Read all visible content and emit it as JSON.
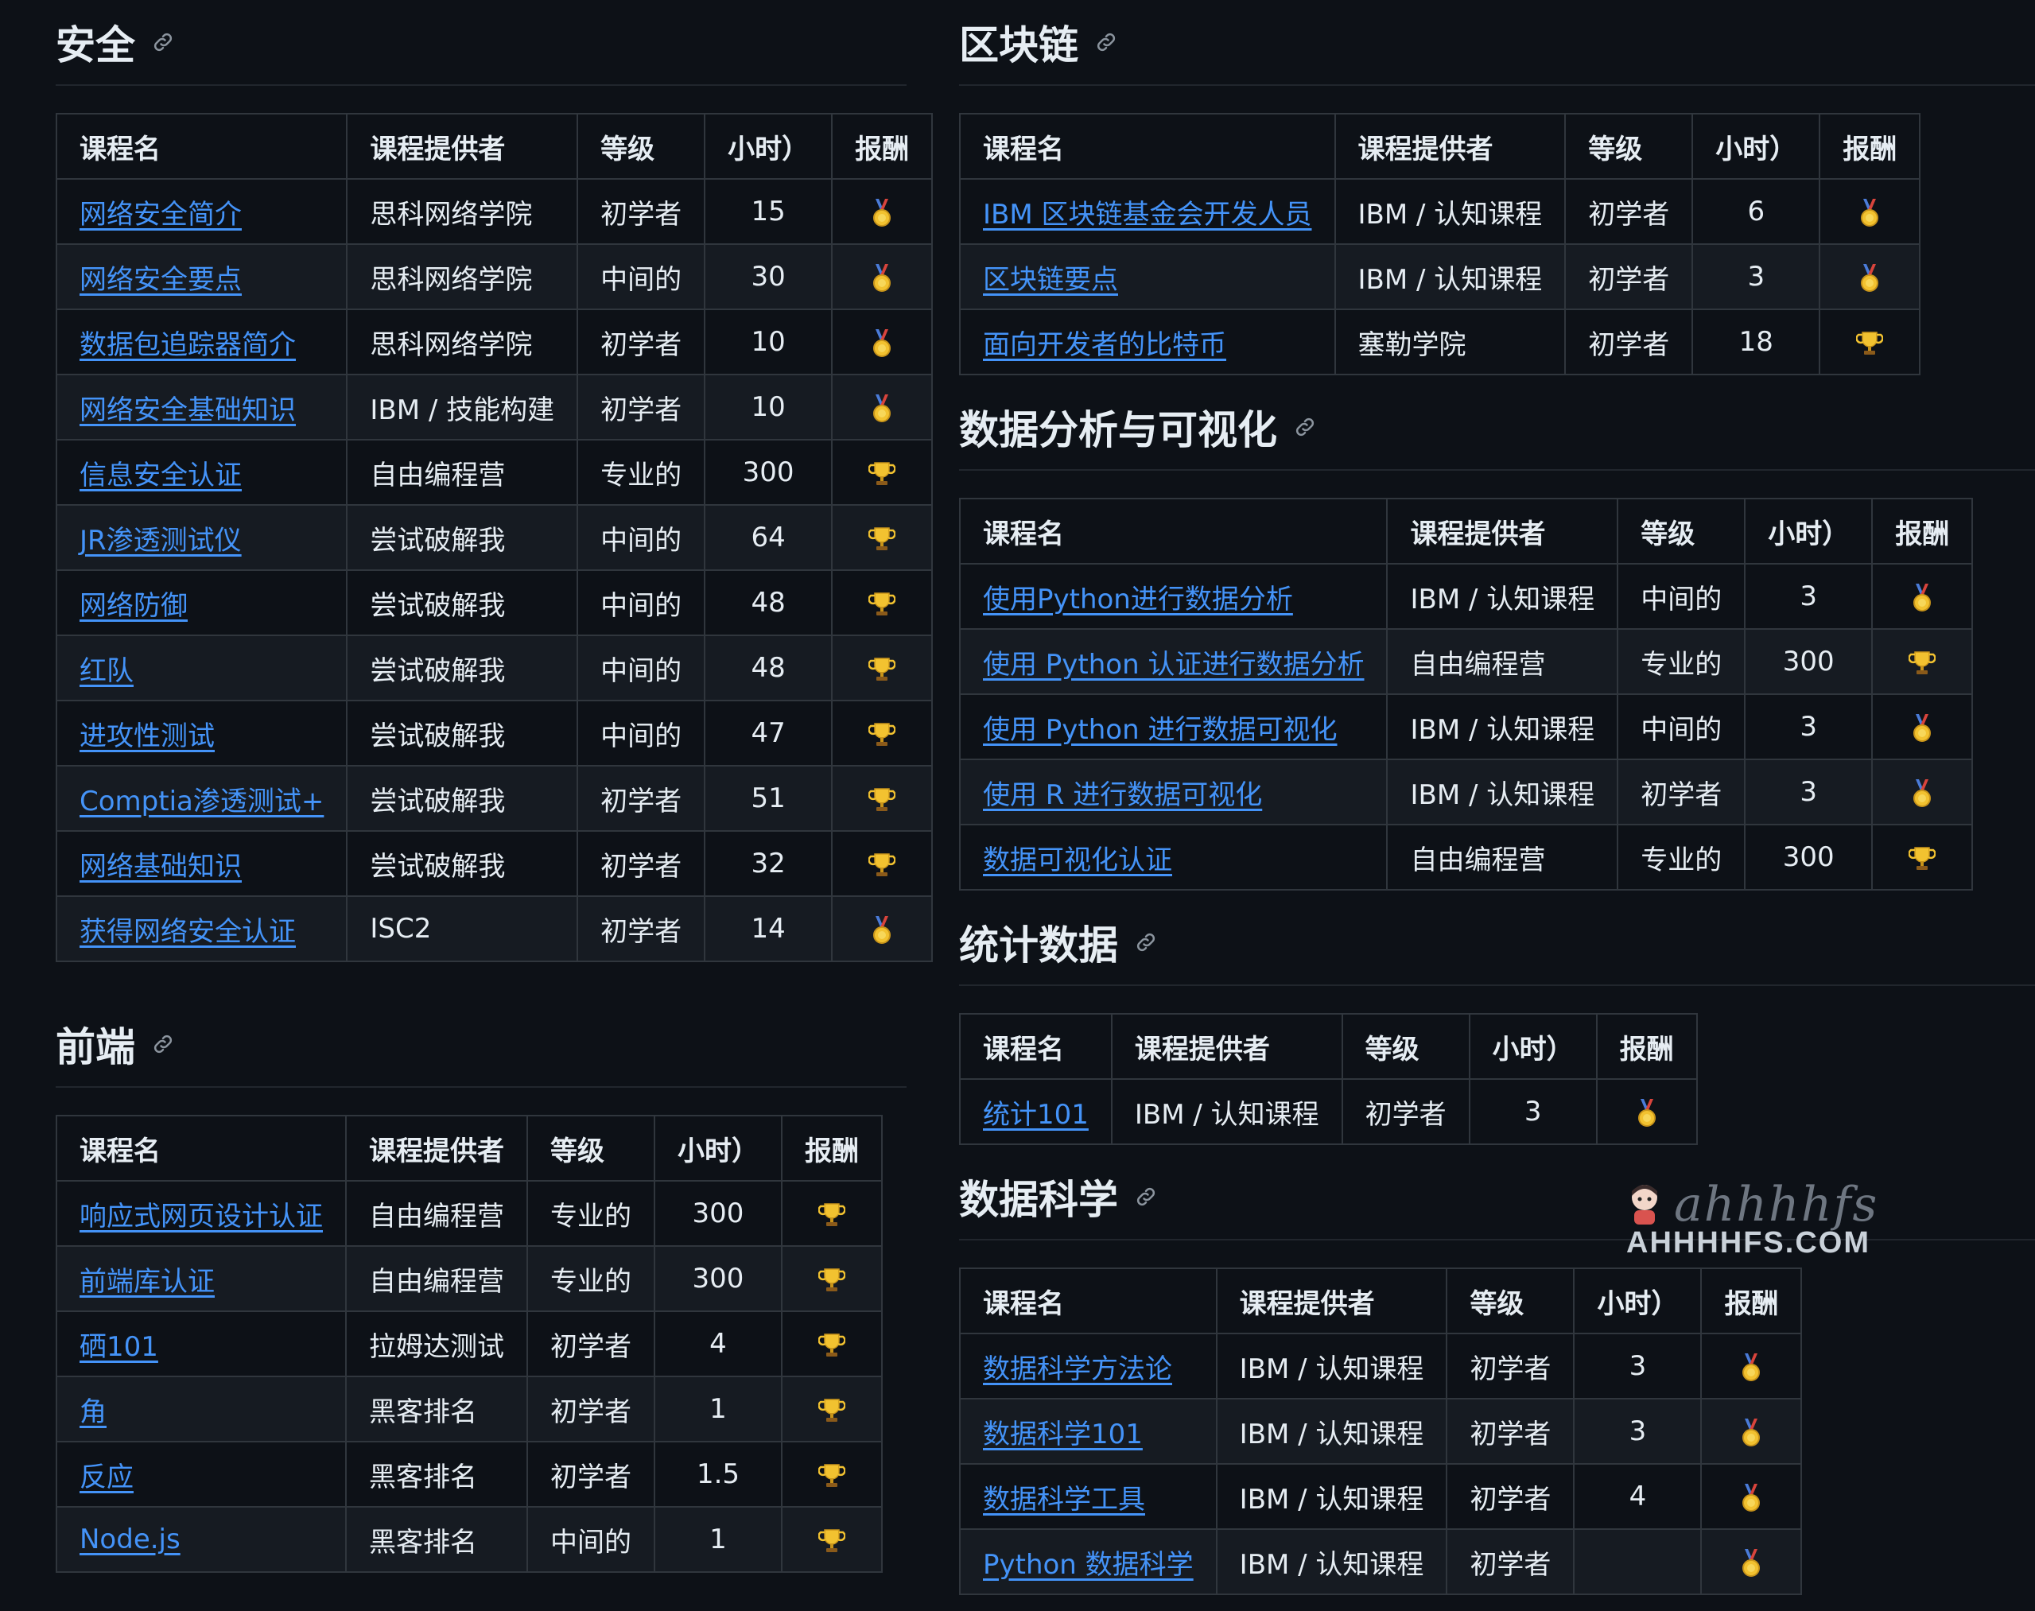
{
  "columns": {
    "name": "课程名",
    "provider": "课程提供者",
    "level": "等级",
    "hours": "小时）",
    "reward": "报酬"
  },
  "sections": {
    "security": {
      "title": "安全",
      "rows": [
        {
          "name": "网络安全简介",
          "provider": "思科网络学院",
          "level": "初学者",
          "hours": "15",
          "reward": "medal"
        },
        {
          "name": "网络安全要点",
          "provider": "思科网络学院",
          "level": "中间的",
          "hours": "30",
          "reward": "medal"
        },
        {
          "name": "数据包追踪器简介",
          "provider": "思科网络学院",
          "level": "初学者",
          "hours": "10",
          "reward": "medal"
        },
        {
          "name": "网络安全基础知识",
          "provider": "IBM / 技能构建",
          "level": "初学者",
          "hours": "10",
          "reward": "medal"
        },
        {
          "name": "信息安全认证",
          "provider": "自由编程营",
          "level": "专业的",
          "hours": "300",
          "reward": "trophy"
        },
        {
          "name": "JR渗透测试仪",
          "provider": "尝试破解我",
          "level": "中间的",
          "hours": "64",
          "reward": "trophy"
        },
        {
          "name": "网络防御",
          "provider": "尝试破解我",
          "level": "中间的",
          "hours": "48",
          "reward": "trophy"
        },
        {
          "name": "红队",
          "provider": "尝试破解我",
          "level": "中间的",
          "hours": "48",
          "reward": "trophy"
        },
        {
          "name": "进攻性测试",
          "provider": "尝试破解我",
          "level": "中间的",
          "hours": "47",
          "reward": "trophy"
        },
        {
          "name": "Comptia渗透测试+",
          "provider": "尝试破解我",
          "level": "初学者",
          "hours": "51",
          "reward": "trophy"
        },
        {
          "name": "网络基础知识",
          "provider": "尝试破解我",
          "level": "初学者",
          "hours": "32",
          "reward": "trophy"
        },
        {
          "name": "获得网络安全认证",
          "provider": "ISC2",
          "level": "初学者",
          "hours": "14",
          "reward": "medal"
        }
      ]
    },
    "frontend": {
      "title": "前端",
      "rows": [
        {
          "name": "响应式网页设计认证",
          "provider": "自由编程营",
          "level": "专业的",
          "hours": "300",
          "reward": "trophy"
        },
        {
          "name": "前端库认证",
          "provider": "自由编程营",
          "level": "专业的",
          "hours": "300",
          "reward": "trophy"
        },
        {
          "name": "硒101",
          "provider": "拉姆达测试",
          "level": "初学者",
          "hours": "4",
          "reward": "trophy"
        },
        {
          "name": "角",
          "provider": "黑客排名",
          "level": "初学者",
          "hours": "1",
          "reward": "trophy"
        },
        {
          "name": "反应",
          "provider": "黑客排名",
          "level": "初学者",
          "hours": "1.5",
          "reward": "trophy"
        },
        {
          "name": "Node.js",
          "provider": "黑客排名",
          "level": "中间的",
          "hours": "1",
          "reward": "trophy"
        }
      ]
    },
    "blockchain": {
      "title": "区块链",
      "rows": [
        {
          "name": "IBM 区块链基金会开发人员",
          "provider": "IBM / 认知课程",
          "level": "初学者",
          "hours": "6",
          "reward": "medal"
        },
        {
          "name": "区块链要点",
          "provider": "IBM / 认知课程",
          "level": "初学者",
          "hours": "3",
          "reward": "medal"
        },
        {
          "name": "面向开发者的比特币",
          "provider": "塞勒学院",
          "level": "初学者",
          "hours": "18",
          "reward": "trophy"
        }
      ]
    },
    "data_viz": {
      "title": "数据分析与可视化",
      "rows": [
        {
          "name": "使用Python进行数据分析",
          "provider": "IBM / 认知课程",
          "level": "中间的",
          "hours": "3",
          "reward": "medal"
        },
        {
          "name": "使用 Python 认证进行数据分析",
          "provider": "自由编程营",
          "level": "专业的",
          "hours": "300",
          "reward": "trophy"
        },
        {
          "name": "使用 Python 进行数据可视化",
          "provider": "IBM / 认知课程",
          "level": "中间的",
          "hours": "3",
          "reward": "medal"
        },
        {
          "name": "使用 R 进行数据可视化",
          "provider": "IBM / 认知课程",
          "level": "初学者",
          "hours": "3",
          "reward": "medal"
        },
        {
          "name": "数据可视化认证",
          "provider": "自由编程营",
          "level": "专业的",
          "hours": "300",
          "reward": "trophy"
        }
      ]
    },
    "statistics": {
      "title": "统计数据",
      "rows": [
        {
          "name": "统计101",
          "provider": "IBM / 认知课程",
          "level": "初学者",
          "hours": "3",
          "reward": "medal"
        }
      ]
    },
    "data_science": {
      "title": "数据科学",
      "rows": [
        {
          "name": "数据科学方法论",
          "provider": "IBM / 认知课程",
          "level": "初学者",
          "hours": "3",
          "reward": "medal"
        },
        {
          "name": "数据科学101",
          "provider": "IBM / 认知课程",
          "level": "初学者",
          "hours": "3",
          "reward": "medal"
        },
        {
          "name": "数据科学工具",
          "provider": "IBM / 认知课程",
          "level": "初学者",
          "hours": "4",
          "reward": "medal"
        },
        {
          "name": "Python 数据科学",
          "provider": "IBM / 认知课程",
          "level": "初学者",
          "hours": "",
          "reward": "medal"
        }
      ]
    }
  },
  "watermark": {
    "logo": "ahhhhfs",
    "text": "AHHHHFS.COM"
  },
  "colors": {
    "background": "#0d1117",
    "link": "#4493f8",
    "border": "#30363d",
    "text": "#e6edf3"
  }
}
